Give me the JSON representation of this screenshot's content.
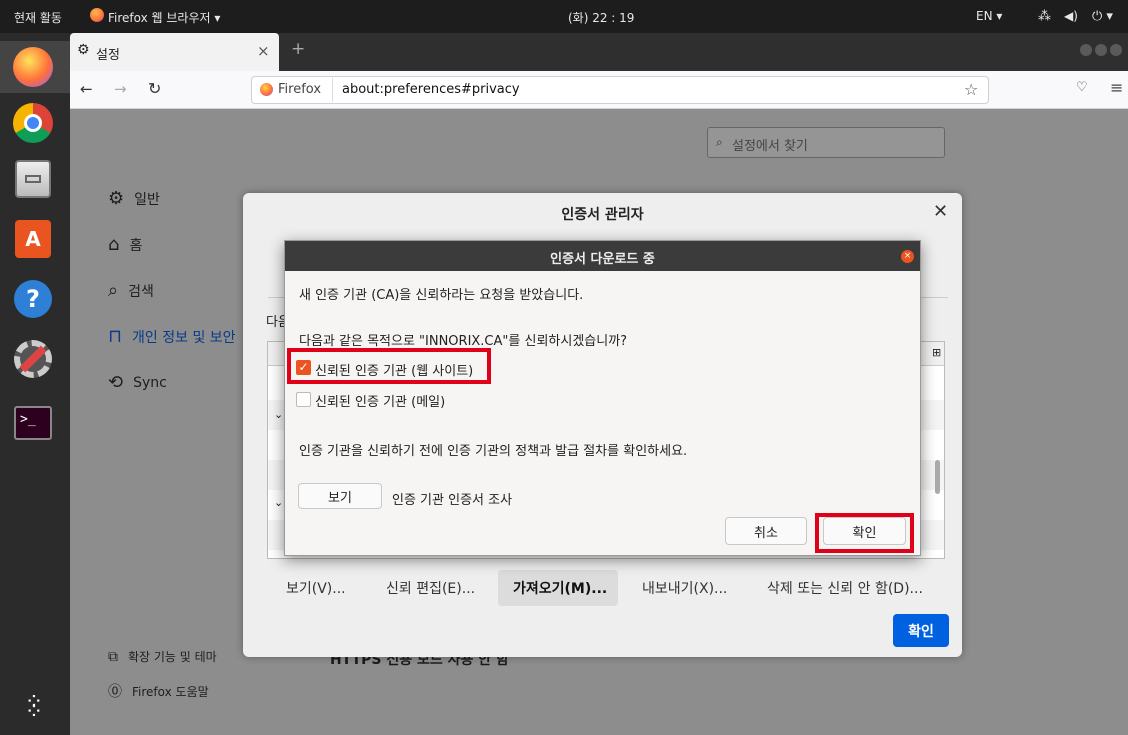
{
  "topbar": {
    "activities": "현재 활동",
    "app_menu": "Firefox 웹 브라우저 ▾",
    "clock": "(화) 22 : 19",
    "lang": "EN ▾"
  },
  "tab": {
    "title": "설정",
    "close": "×",
    "new_tab": "+"
  },
  "nav": {
    "url_brand": "Firefox",
    "url": "about:preferences#privacy"
  },
  "prefs": {
    "search_placeholder": "설정에서 찾기",
    "items": [
      "일반",
      "홈",
      "검색",
      "개인 정보 및 보안",
      "Sync"
    ],
    "bottom_items": [
      "확장 기능 및 테마",
      "Firefox 도움말"
    ],
    "partial_label": "다음",
    "hidden_text": "HTTPS 전용 모드 사용 안 함"
  },
  "cert_manager": {
    "title": "인증서 관리자",
    "buttons": [
      "보기(V)...",
      "신뢰 편집(E)...",
      "가져오기(M)...",
      "내보내기(X)...",
      "삭제 또는 신뢰 안 함(D)..."
    ],
    "ok": "확인"
  },
  "download_dialog": {
    "title": "인증서 다운로드 중",
    "line1": "새 인증 기관 (CA)을 신뢰하라는 요청을 받았습니다.",
    "line2": "다음과 같은 목적으로 \"INNORIX.CA\"를 신뢰하시겠습니까?",
    "check_web": "신뢰된 인증 기관 (웹 사이트)",
    "check_web_checked": true,
    "check_mail": "신뢰된 인증 기관 (메일)",
    "check_mail_checked": false,
    "line3": "인증 기관을 신뢰하기 전에 인증 기관의 정책과 발급 절차를 확인하세요.",
    "view_button": "보기",
    "view_desc": "인증 기관 인증서 조사",
    "cancel": "취소",
    "ok": "확인"
  },
  "colors": {
    "highlight": "#e00018",
    "primary": "#0061e0",
    "firefox_orange": "#ff7139"
  }
}
